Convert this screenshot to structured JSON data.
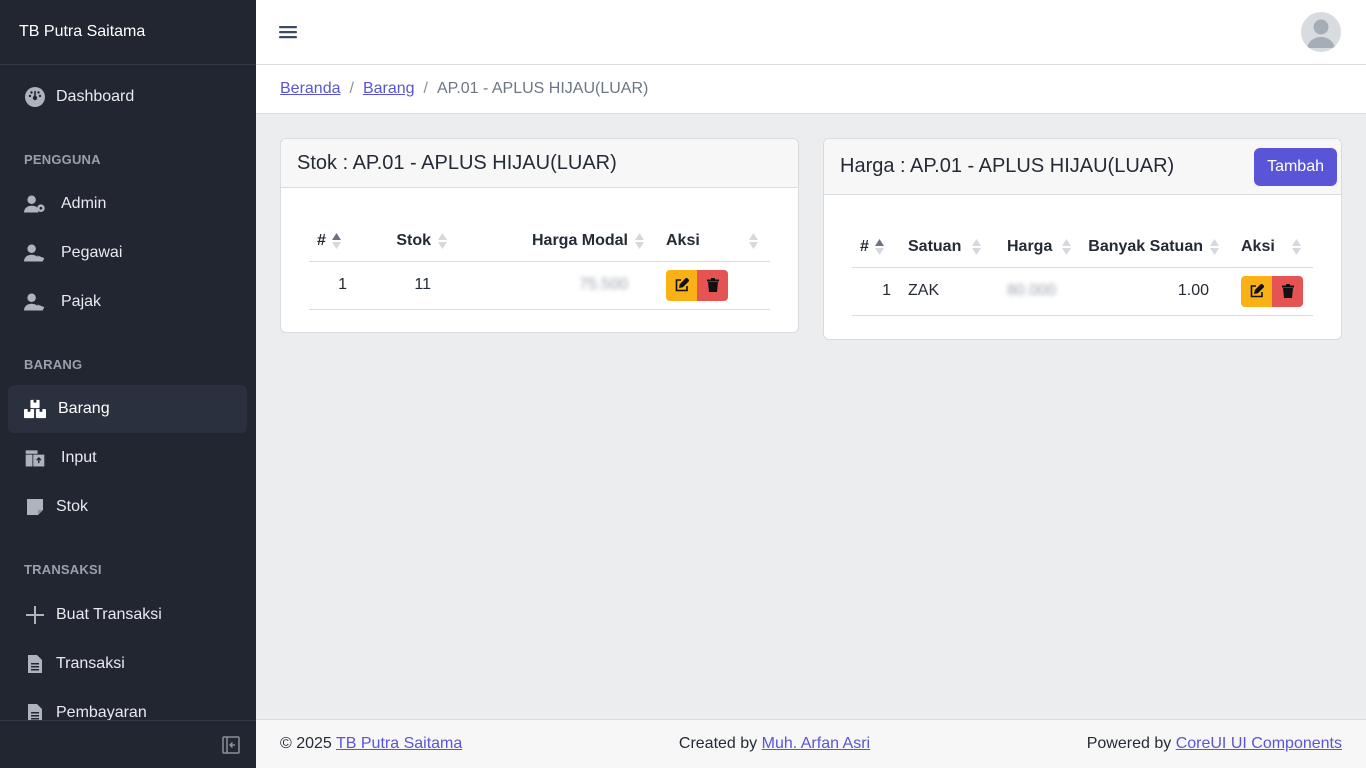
{
  "app": {
    "brand": "TB Putra Saitama"
  },
  "sidebar": {
    "items": [
      {
        "label": "Dashboard",
        "icon": "speedometer-icon"
      },
      {
        "section": "PENGGUNA"
      },
      {
        "label": "Admin",
        "icon": "user-gear-icon"
      },
      {
        "label": "Pegawai",
        "icon": "user-tie-icon"
      },
      {
        "label": "Pajak",
        "icon": "user-tag-icon"
      },
      {
        "section": "BARANG"
      },
      {
        "label": "Barang",
        "icon": "boxes-icon",
        "active": true
      },
      {
        "label": "Input",
        "icon": "pallet-icon"
      },
      {
        "label": "Stok",
        "icon": "sticky-note-icon"
      },
      {
        "section": "TRANSAKSI"
      },
      {
        "label": "Buat Transaksi",
        "icon": "plus-icon"
      },
      {
        "label": "Transaksi",
        "icon": "document-icon"
      },
      {
        "label": "Pembayaran",
        "icon": "document-icon"
      }
    ]
  },
  "breadcrumb": {
    "home": "Beranda",
    "parent": "Barang",
    "sep": "/",
    "current": "AP.01 - APLUS HIJAU(LUAR)"
  },
  "stock_card": {
    "title": "Stok : AP.01 - APLUS HIJAU(LUAR)",
    "columns": [
      "#",
      "Stok",
      "Harga Modal",
      "Aksi"
    ],
    "rows": [
      {
        "no": "1",
        "stok": "11",
        "harga_modal": "75.500"
      }
    ]
  },
  "price_card": {
    "title": "Harga : AP.01 - APLUS HIJAU(LUAR)",
    "add_label": "Tambah",
    "columns": [
      "#",
      "Satuan",
      "Harga",
      "Banyak Satuan",
      "Aksi"
    ],
    "rows": [
      {
        "no": "1",
        "satuan": "ZAK",
        "harga": "80.000",
        "banyak": "1.00"
      }
    ]
  },
  "footer": {
    "copyright": "© 2025",
    "brand_link": "TB Putra Saitama",
    "created_by": "Created by",
    "author": "Muh. Arfan Asri",
    "powered_by": "Powered by",
    "powered_link": "CoreUI UI Components"
  },
  "colors": {
    "sidebar_bg": "#212631",
    "primary": "#5856d6",
    "warning": "#f9b115",
    "danger": "#e55353"
  }
}
